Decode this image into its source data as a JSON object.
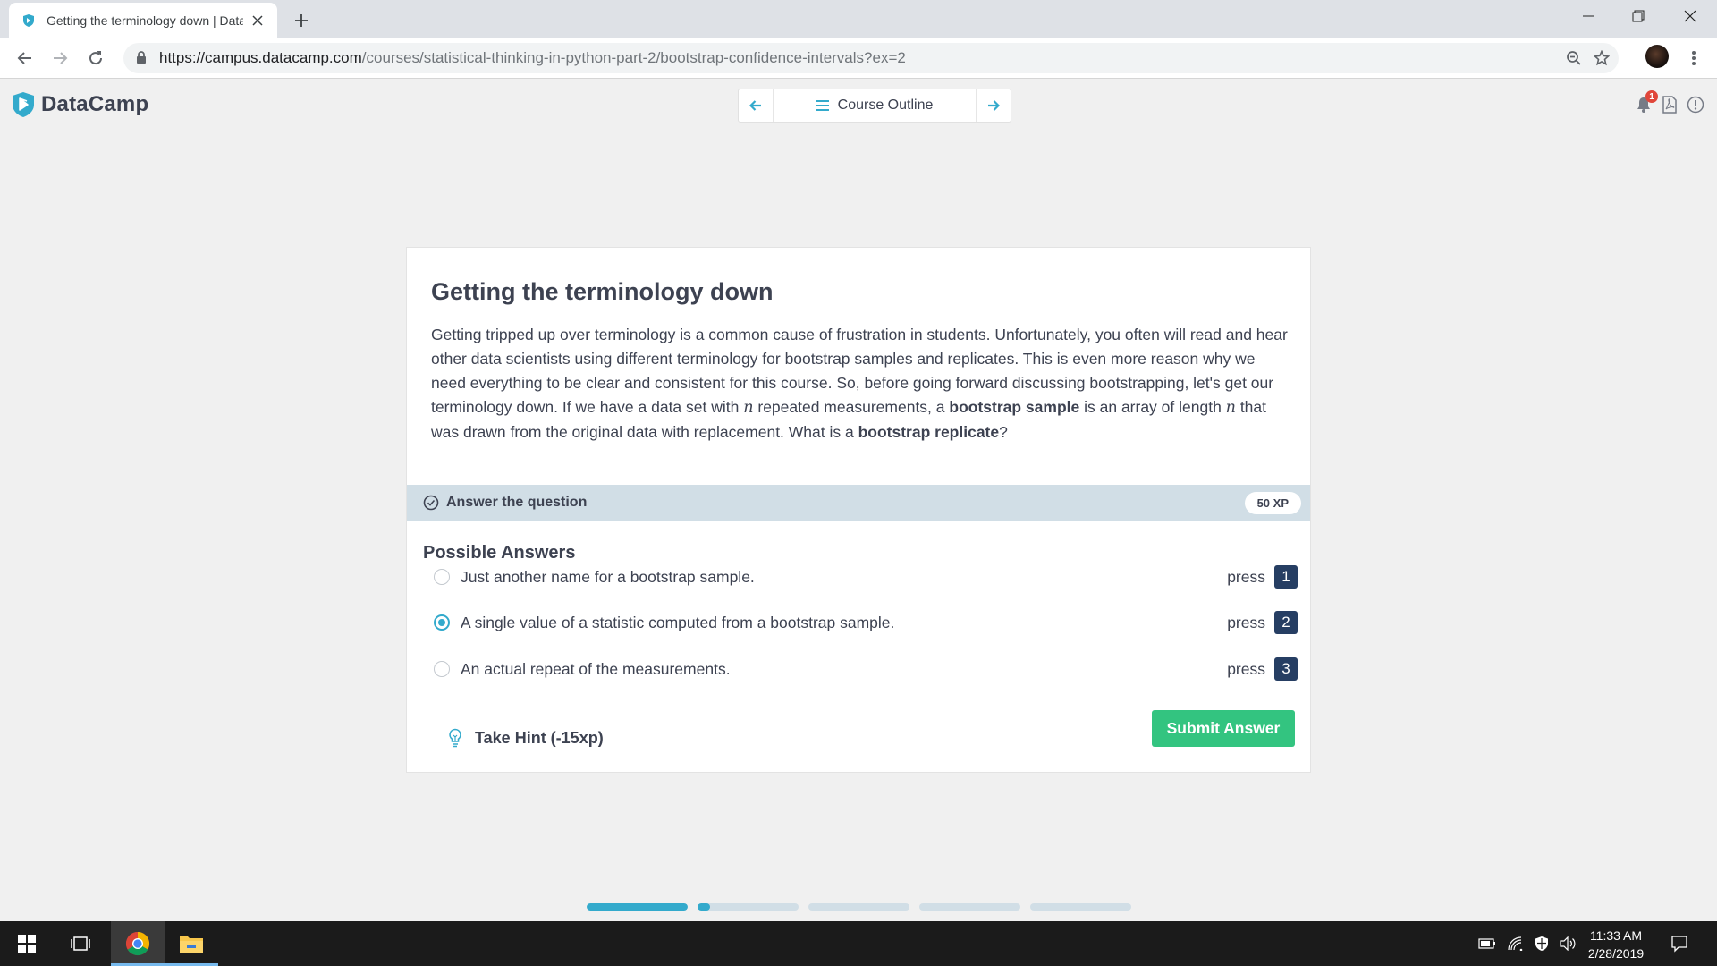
{
  "browser": {
    "tab_title": "Getting the terminology down | DataCamp",
    "url_host": "https://campus.datacamp.com",
    "url_path": "/courses/statistical-thinking-in-python-part-2/bootstrap-confidence-intervals?ex=2"
  },
  "app": {
    "logo_text": "DataCamp",
    "course_outline_label": "Course Outline",
    "notification_count": "1"
  },
  "exercise": {
    "title": "Getting the terminology down",
    "body": {
      "p1": "Getting tripped up over terminology is a common cause of frustration in students. Unfortunately, you often will read and hear other data scientists using different terminology for bootstrap samples and replicates. This is even more reason why we need everything to be clear and consistent for this course. So, before going forward discussing bootstrapping, let's get our terminology down. If we have a data set with ",
      "n1": "n",
      "p2": " repeated measurements, a ",
      "b1": "bootstrap sample",
      "p3": " is an array of length ",
      "n2": "n",
      "p4": " that was drawn from the original data with replacement. What is a ",
      "b2": "bootstrap replicate",
      "p5": "?"
    },
    "question_label": "Answer the question",
    "xp": "50 XP",
    "possible_answers_title": "Possible Answers",
    "answers": [
      {
        "text": "Just another name for a bootstrap sample.",
        "press": "press",
        "key": "1",
        "selected": false
      },
      {
        "text": "A single value of a statistic computed from a bootstrap sample.",
        "press": "press",
        "key": "2",
        "selected": true
      },
      {
        "text": "An actual repeat of the measurements.",
        "press": "press",
        "key": "3",
        "selected": false
      }
    ],
    "hint_label": "Take Hint (-15xp)",
    "submit_label": "Submit Answer"
  },
  "progress": {
    "segments": [
      1.0,
      0.12,
      0,
      0,
      0
    ]
  },
  "taskbar": {
    "time": "11:33 AM",
    "date": "2/28/2019"
  },
  "colors": {
    "accent_blue": "#33aacc",
    "submit_green": "#33c480",
    "key_navy": "#263e63",
    "question_bar": "#d1dee6",
    "text_dark": "#3d4251"
  }
}
